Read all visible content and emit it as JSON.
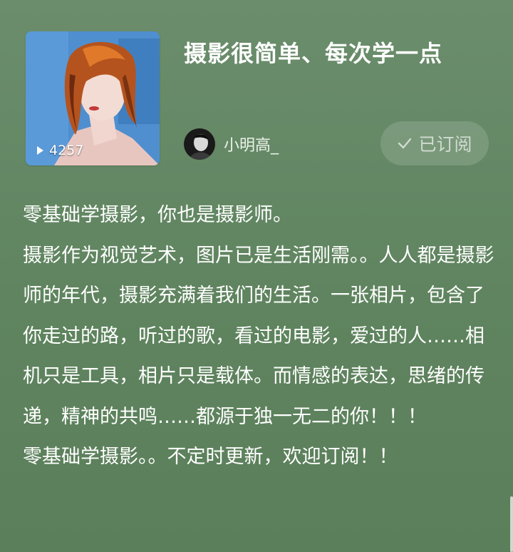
{
  "album": {
    "title": "摄影很简单、每次学一点",
    "play_count": "4257",
    "cover_icon": "portrait-painting"
  },
  "author": {
    "name": "小明高_"
  },
  "subscribe": {
    "label": "已订阅",
    "icon": "check-icon"
  },
  "description": [
    "零基础学摄影，你也是摄影师。",
    "摄影作为视觉艺术，图片已是生活刚需。。人人都是摄影师的年代，摄影充满着我们的生活。一张相片，包含了你走过的路，听过的歌，看过的电影，爱过的人……相机只是工具，相片只是载体。而情感的表达，思绪的传递，精神的共鸣……都源于独一无二的你！！！",
    "零基础学摄影。。不定时更新，欢迎订阅！！"
  ],
  "colors": {
    "background": "#638763",
    "text": "#ffffff"
  }
}
